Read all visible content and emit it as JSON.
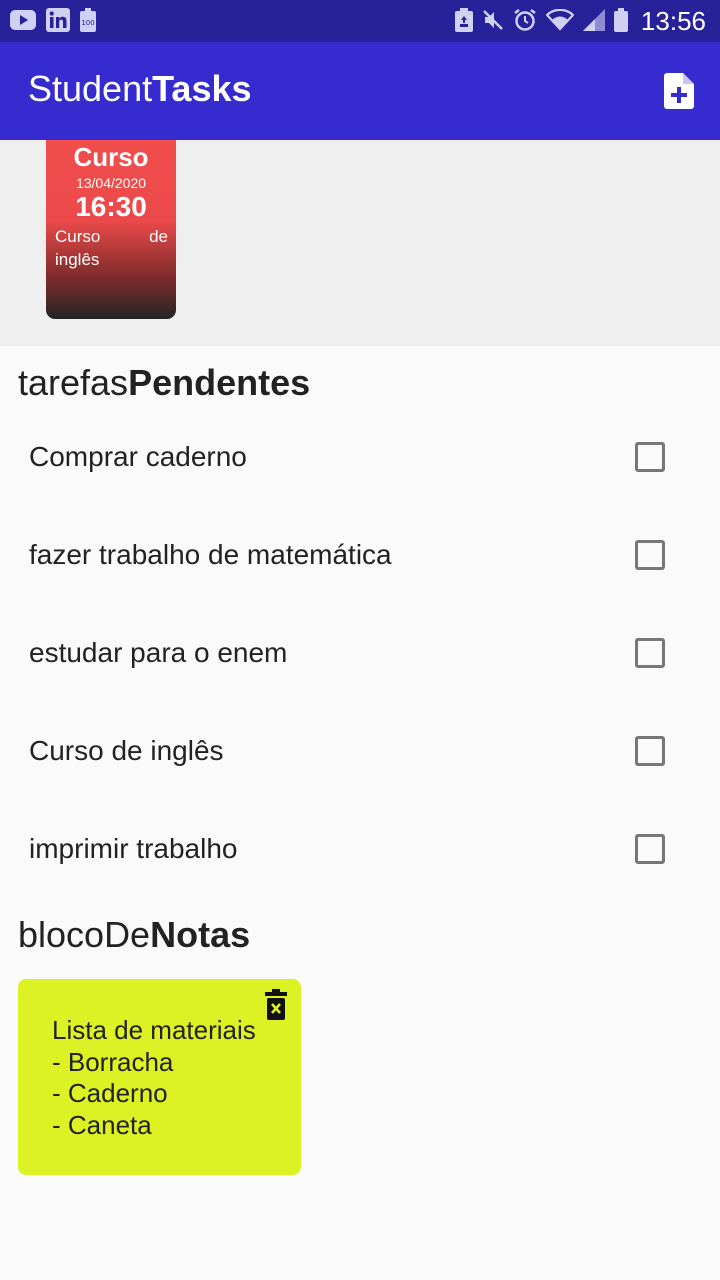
{
  "status_bar": {
    "time": "13:56",
    "battery_level_label": "100",
    "left_icons": [
      "youtube-icon",
      "linkedin-icon",
      "battery-saver-icon"
    ],
    "right_icons": [
      "recycle-icon",
      "mute-icon",
      "alarm-icon",
      "wifi-icon",
      "signal-icon",
      "battery-icon"
    ]
  },
  "app_bar": {
    "title_light": "Student",
    "title_bold": "Tasks",
    "action_icon": "add-file-icon"
  },
  "events": [
    {
      "title": "Curso",
      "date": "13/04/2020",
      "time": "16:30",
      "description": "Curso de inglês"
    }
  ],
  "tasks_section": {
    "title_light": "tarefas",
    "title_bold": "Pendentes"
  },
  "tasks": [
    {
      "label": "Comprar caderno",
      "checked": false
    },
    {
      "label": "fazer trabalho de matemática",
      "checked": false
    },
    {
      "label": "estudar para o enem",
      "checked": false
    },
    {
      "label": "Curso de inglês",
      "checked": false
    },
    {
      "label": "imprimir trabalho",
      "checked": false
    }
  ],
  "notes_section": {
    "title_light": "blocoDe",
    "title_bold": "Notas"
  },
  "notes": [
    {
      "text": "Lista de materiais\n- Borracha\n- Caderno\n- Caneta",
      "color": "#dcf224",
      "action_icon": "delete-icon"
    }
  ],
  "colors": {
    "status_bar": "#27229a",
    "app_bar": "#352bce",
    "event_card_top": "#f04d4d",
    "event_card_bottom": "#252525",
    "background": "#fafafa",
    "events_background": "#efefef"
  }
}
